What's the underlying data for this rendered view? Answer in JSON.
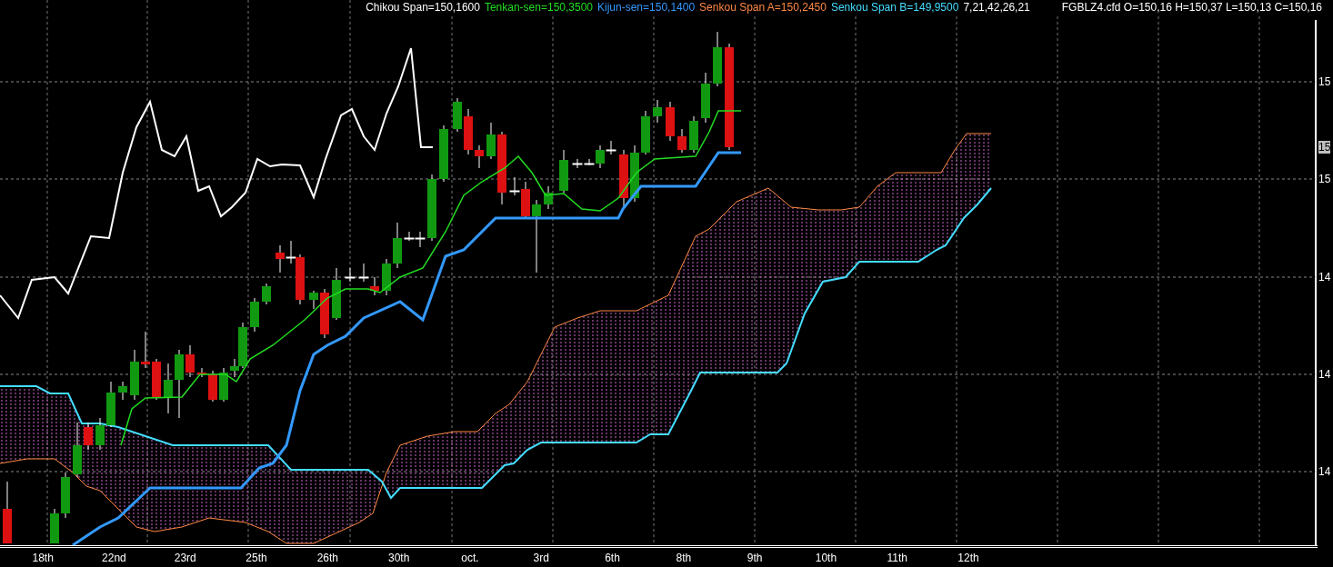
{
  "legend": [
    {
      "text": "Chikou Span=150,1600",
      "color": "#ffffff"
    },
    {
      "text": "Tenkan-sen=150,3500",
      "color": "#22dd22"
    },
    {
      "text": "Kijun-sen=150,1400",
      "color": "#3399ff"
    },
    {
      "text": "Senkou Span A=150,2450",
      "color": "#ff8844"
    },
    {
      "text": "Senkou Span B=149,9500",
      "color": "#44ddff"
    },
    {
      "text": "7,21,42,26,21",
      "color": "#ffffff"
    },
    {
      "text": "FGBLZ4.cfd O=150,16 H=150,37 L=150,13 C=150,16",
      "color": "#ffffff"
    }
  ],
  "price_axis": [
    {
      "label": "15",
      "highlighted": false
    },
    {
      "label": "15",
      "highlighted": true
    },
    {
      "label": "15",
      "highlighted": false
    },
    {
      "label": "14",
      "highlighted": false
    },
    {
      "label": "14",
      "highlighted": false
    },
    {
      "label": "14",
      "highlighted": false
    }
  ],
  "date_axis": [
    "18th",
    "22nd",
    "23rd",
    "25th",
    "26th",
    "30th",
    "oct.",
    "3rd",
    "6th",
    "8th",
    "9th",
    "10th",
    "11th",
    "12th"
  ]
}
